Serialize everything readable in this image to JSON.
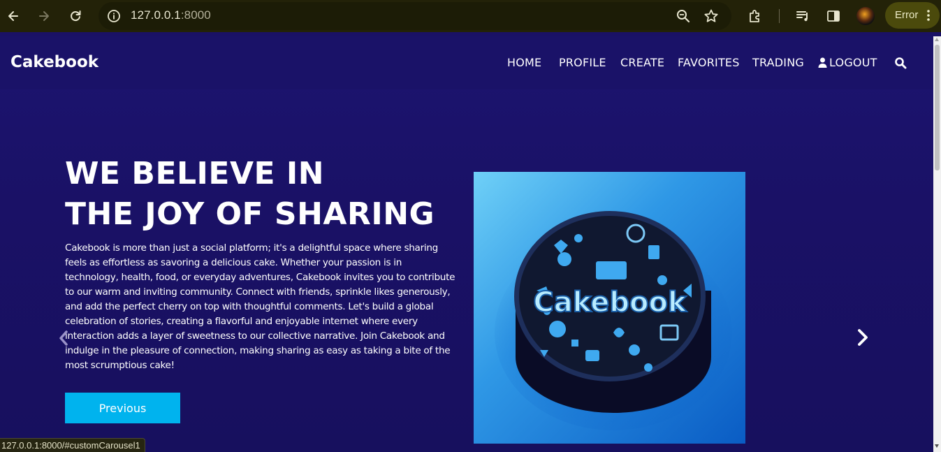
{
  "browser": {
    "url_host": "127.0.0.1",
    "url_port": ":8000",
    "profile_status": "Error",
    "status_url": "127.0.0.1:8000/#customCarousel1"
  },
  "site": {
    "brand": "Cakebook",
    "nav": [
      {
        "label": "HOME"
      },
      {
        "label": "PROFILE"
      },
      {
        "label": "CREATE"
      },
      {
        "label": "FAVORITES"
      },
      {
        "label": "TRADING"
      },
      {
        "label": "LOGOUT",
        "icon": "user-icon"
      }
    ],
    "search_icon": "search-icon"
  },
  "hero": {
    "headline_line1": "WE BELIEVE IN",
    "headline_line2": "THE JOY OF SHARING",
    "description": "Cakebook is more than just a social platform; it's a delightful space where sharing feels as effortless as savoring a delicious cake. Whether your passion is in technology, health, food, or everyday adventures, Cakebook invites you to contribute to our warm and inviting community. Connect with friends, sprinkle likes generously, and add the perfect cherry on top with thoughtful comments. Let's build a global celebration of stories, creating a flavorful and enjoyable internet where every interaction adds a layer of sweetness to our collective narrative. Join Cakebook and indulge in the pleasure of connection, making sharing as easy as taking a bite of the most scrumptious cake!",
    "button_label": "Previous",
    "image_text": "Cakebook"
  },
  "colors": {
    "page_bg": "#1a1166",
    "button_bg": "#00b3ee",
    "chrome_bg": "#232208"
  }
}
